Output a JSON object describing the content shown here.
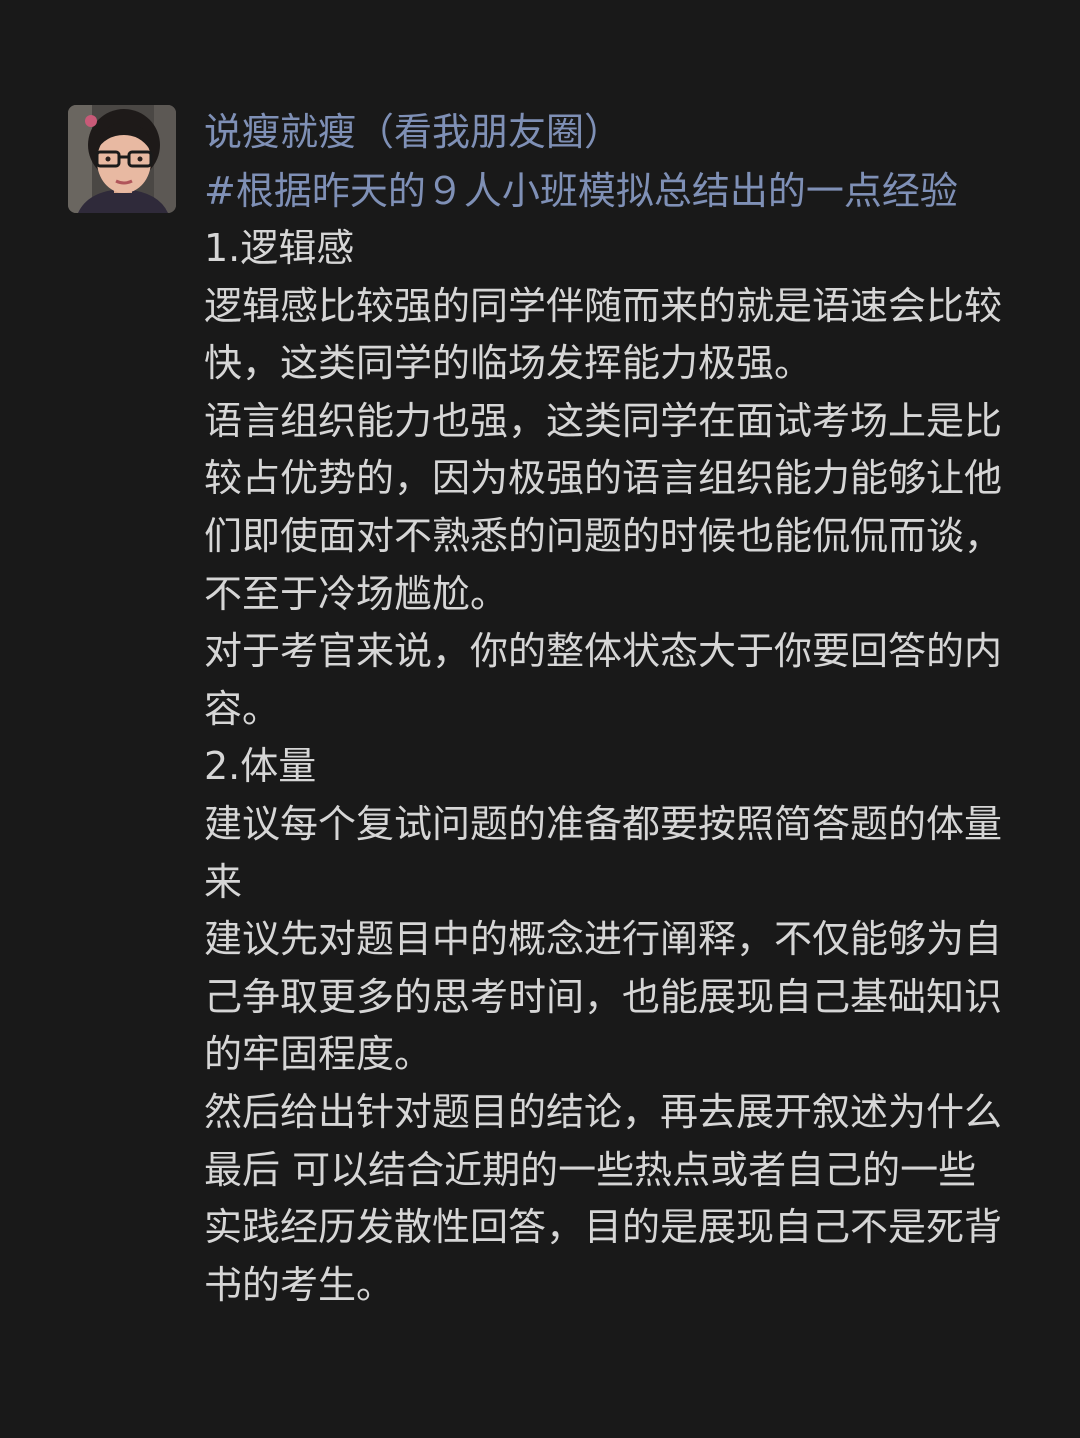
{
  "post": {
    "nickname": "说瘦就瘦（看我朋友圈）",
    "topic": "#根据昨天的９人小班模拟总结出的一点经验",
    "lines": [
      "1.逻辑感",
      "逻辑感比较强的同学伴随而来的就是语速会比较快，这类同学的临场发挥能力极强。",
      "语言组织能力也强，这类同学在面试考场上是比较占优势的，因为极强的语言组织能力能够让他们即使面对不熟悉的问题的时候也能侃侃而谈，不至于冷场尴尬。",
      "对于考官来说，你的整体状态大于你要回答的内容。",
      "2.体量",
      "建议每个复试问题的准备都要按照简答题的体量来",
      "建议先对题目中的概念进行阐释，不仅能够为自己争取更多的思考时间，也能展现自己基础知识的牢固程度。",
      "然后给出针对题目的结论，再去展开叙述为什么",
      "最后 可以结合近期的一些热点或者自己的一些实践经历发散性回答，目的是展现自己不是死背书的考生。"
    ]
  },
  "colors": {
    "background": "#191919",
    "link": "#7f90b6",
    "text": "#d6d6d6"
  }
}
